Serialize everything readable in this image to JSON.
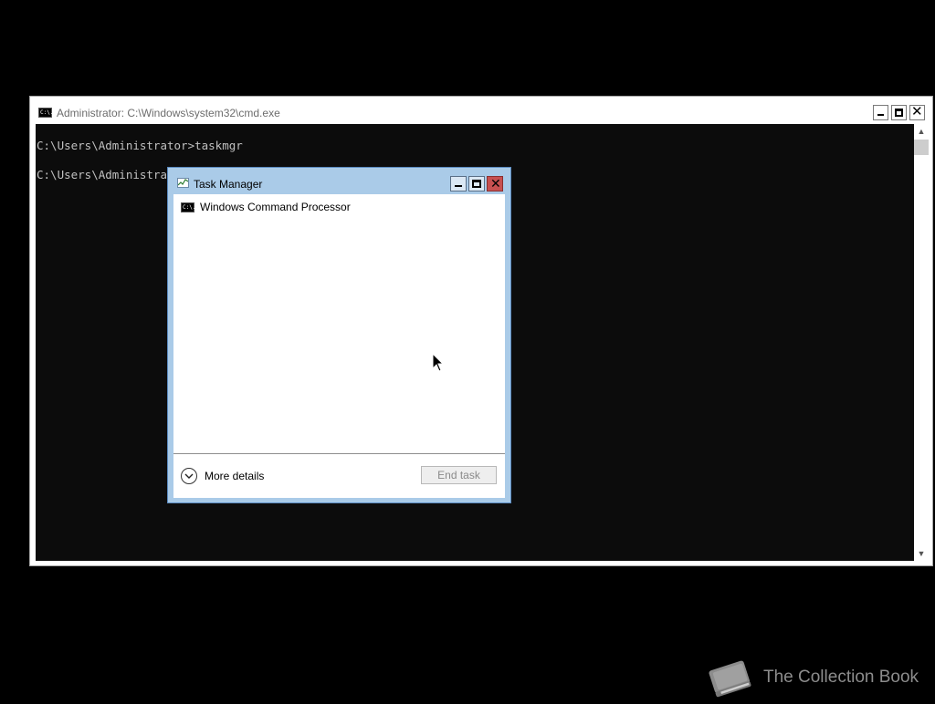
{
  "cmd_window": {
    "title": "Administrator: C:\\Windows\\system32\\cmd.exe",
    "icon": "cmd-icon",
    "icon_glyph": "C:\\.",
    "console_lines": [
      "C:\\Users\\Administrator>taskmgr",
      "C:\\Users\\Administrator>"
    ],
    "scroll_up": "▲",
    "scroll_down": "▼"
  },
  "task_manager": {
    "title": "Task Manager",
    "icon": "task-manager-icon",
    "close_glyph": "✕",
    "processes": [
      {
        "name": "Windows Command Processor",
        "icon": "cmd-icon",
        "icon_glyph": "C:\\."
      }
    ],
    "more_details_label": "More details",
    "end_task_label": "End task",
    "end_task_enabled": false
  },
  "watermark": {
    "text": "The Collection Book",
    "icon": "book-icon"
  }
}
